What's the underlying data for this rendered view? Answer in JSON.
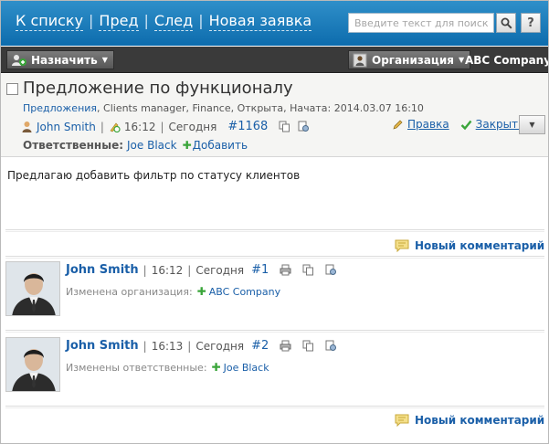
{
  "nav": {
    "to_list": "К списку",
    "prev": "Пред",
    "next": "След",
    "new_ticket": "Новая заявка",
    "separator": "|"
  },
  "search": {
    "placeholder": "Введите текст для поиска",
    "search_icon": "magnifier-icon",
    "help_label": "?"
  },
  "toolbar": {
    "assign_label": "Назначить",
    "org_label": "Организация",
    "org_value": "ABC Company"
  },
  "ticket": {
    "title": "Предложение по функционалу",
    "category": "Предложения",
    "meta_rest": ", Clients manager, Finance, Открыта, Начата: 2014.03.07 16:10",
    "author": "John Smith",
    "time": "16:12",
    "day": "Сегодня",
    "number": "#1168",
    "responsible_label": "Ответственные:",
    "responsible_value": "Joe Black",
    "add_label": "Добавить",
    "edit_label": "Правка",
    "close_label": "Закрыть"
  },
  "description": "Предлагаю добавить фильтр по статусу клиентов",
  "new_comment_label": "Новый комментарий",
  "comments": [
    {
      "author": "John Smith",
      "time": "16:12",
      "day": "Сегодня",
      "number": "#1",
      "change_label": "Изменена организация:",
      "change_value": "ABC Company"
    },
    {
      "author": "John Smith",
      "time": "16:13",
      "day": "Сегодня",
      "number": "#2",
      "change_label": "Изменены ответственные:",
      "change_value": "Joe Black"
    }
  ],
  "colors": {
    "header_blue": "#1479bd",
    "link_blue": "#1a5fa8",
    "toolbar_dark": "#3a3a3a",
    "add_green": "#3aa53a"
  }
}
